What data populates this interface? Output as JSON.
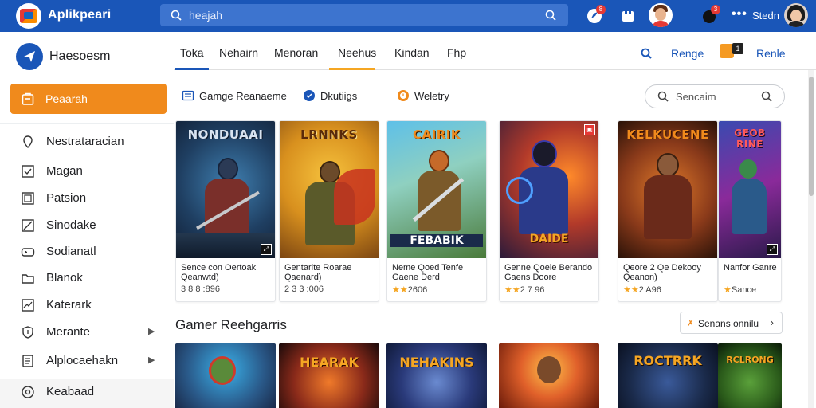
{
  "app": {
    "title": "Aplikpeari"
  },
  "search": {
    "placeholder": "heajah"
  },
  "topbar": {
    "badge1": "8",
    "badge2": "3",
    "more": "•••",
    "user_name": "Stedn"
  },
  "sidebar": {
    "brand": "Haesoesm",
    "active_item": "Peaarah",
    "items": [
      {
        "label": "Nestrataracian",
        "icon": "location-pin-icon",
        "chevron": false
      },
      {
        "label": "Magan",
        "icon": "check-box-icon",
        "chevron": false
      },
      {
        "label": "Patsion",
        "icon": "image-box-icon",
        "chevron": false
      },
      {
        "label": "Sinodake",
        "icon": "slash-box-icon",
        "chevron": false
      },
      {
        "label": "Sodianatl",
        "icon": "gamepad-icon",
        "chevron": false
      },
      {
        "label": "Blanok",
        "icon": "folder-icon",
        "chevron": false
      },
      {
        "label": "Katerark",
        "icon": "chart-box-icon",
        "chevron": false
      },
      {
        "label": "Merante",
        "icon": "shield-icon",
        "chevron": true
      },
      {
        "label": "Alplocaehakn",
        "icon": "document-icon",
        "chevron": true
      },
      {
        "label": "Keabaad",
        "icon": "settings-circle-icon",
        "chevron": false
      }
    ]
  },
  "tabs": {
    "items": [
      "Toka",
      "Nehairn",
      "Menoran",
      "Neehus",
      "Kindan",
      "Fhp"
    ],
    "right_label_1": "Renge",
    "right_label_2": "Renle",
    "square_badge": "1"
  },
  "filters": [
    {
      "label": "Gamge Reanaeme",
      "icon": "list-icon"
    },
    {
      "label": "Dkutiigs",
      "icon": "circle-check-icon"
    },
    {
      "label": "Weletry",
      "icon": "clock-icon"
    }
  ],
  "search2": {
    "placeholder": "Sencaim"
  },
  "cards": [
    {
      "art_title": "NONDUAAI",
      "art_sub": "",
      "title": "Sence con Oertoak Qeanwtd)",
      "meta": "3 8 8 :896",
      "stars": ""
    },
    {
      "art_title": "LRNNKS",
      "art_sub": "",
      "title": "Gentarite Roarae Qaenard)",
      "meta": "2 3 3 :006",
      "stars": ""
    },
    {
      "art_title": "CAIRIK",
      "art_sub": "FEBABIK",
      "title": "Neme Qoed Tenfe Gaene Derd",
      "meta": "2606",
      "stars": "★★"
    },
    {
      "art_title": "",
      "art_sub": "DAIDE",
      "title": "Genne Qoele Berando Gaens Doore",
      "meta": "2 7 96",
      "stars": "★★"
    },
    {
      "art_title": "KELKUCENE",
      "art_sub": "",
      "title": "Qeore 2 Qe Dekooy Qeanon)",
      "meta": "2 A96",
      "stars": "★★"
    },
    {
      "art_title": "GEOB RINE",
      "art_sub": "",
      "title": "Nanfor Ganre",
      "meta": "Sance",
      "stars": "★"
    }
  ],
  "section": {
    "title": "Gamer Reehgarris",
    "button": "Senans onnilu"
  },
  "thumbs": [
    {
      "title": ""
    },
    {
      "title": "HEARAK"
    },
    {
      "title": "NEHAKINS"
    },
    {
      "title": ""
    },
    {
      "title": "ROCTRRK"
    },
    {
      "title": "RCLRONG"
    }
  ],
  "colors": {
    "topbar": "#1a56b8",
    "accent": "#f08a1c",
    "tab_underline": "#f5a623",
    "star": "#f5a623"
  }
}
